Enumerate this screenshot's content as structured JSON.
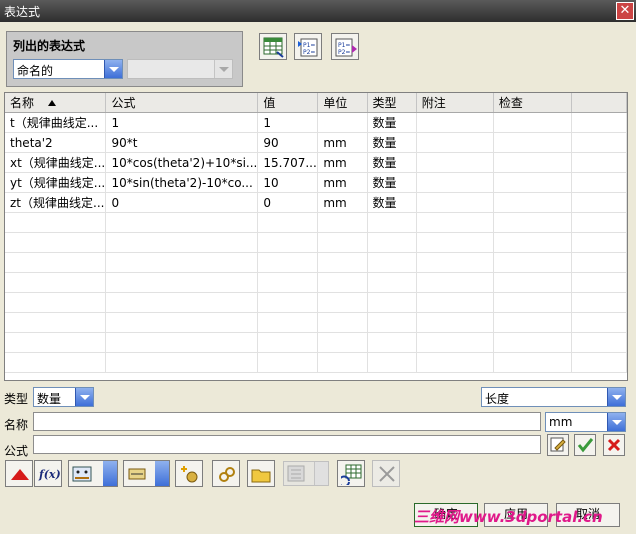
{
  "window": {
    "title": "表达式"
  },
  "list_group": {
    "header": "列出的表达式",
    "filter_value": "命名的",
    "secondary_value": ""
  },
  "table": {
    "columns": [
      "名称",
      "公式",
      "值",
      "单位",
      "类型",
      "附注",
      "检查"
    ],
    "rows": [
      [
        "t（规律曲线定...",
        "1",
        "1",
        "",
        "数量",
        "",
        ""
      ],
      [
        "theta'2",
        "90*t",
        "90",
        "mm",
        "数量",
        "",
        ""
      ],
      [
        "xt（规律曲线定...",
        "10*cos(theta'2)+10*si...",
        "15.707...",
        "mm",
        "数量",
        "",
        ""
      ],
      [
        "yt（规律曲线定...",
        "10*sin(theta'2)-10*co...",
        "10",
        "mm",
        "数量",
        "",
        ""
      ],
      [
        "zt（规律曲线定...",
        "0",
        "0",
        "mm",
        "数量",
        "",
        ""
      ]
    ]
  },
  "form": {
    "type_label": "类型",
    "type_value": "数量",
    "dimension_value": "长度",
    "name_label": "名称",
    "name_value": "",
    "unit_value": "mm",
    "formula_label": "公式",
    "formula_value": ""
  },
  "buttons": {
    "ok": "确定",
    "apply": "应用",
    "cancel": "取消"
  },
  "watermark": "三维网www.3dportal.cn",
  "colors": {
    "accent_blue": "#3e6fd8",
    "title_bar": "#3a3a3a",
    "delete_red": "#d61a1a",
    "check_green": "#3a9a3a"
  }
}
